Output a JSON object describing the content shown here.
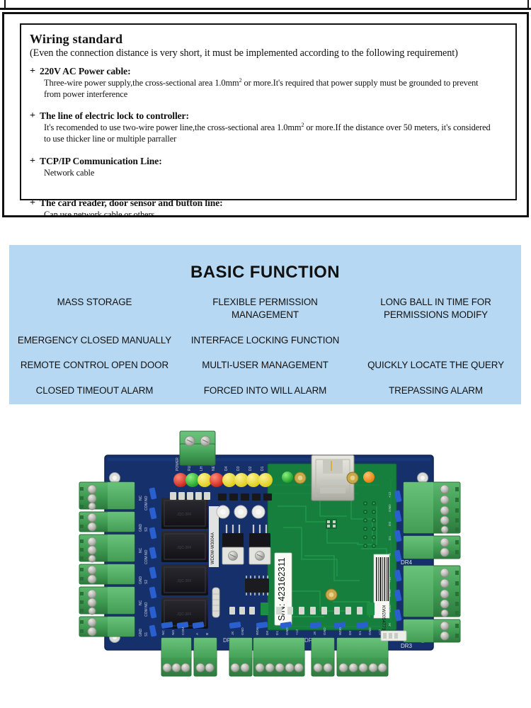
{
  "wiring": {
    "title": "Wiring standard",
    "subtitle": "(Even the connection distance  is very short, it must be implemented  according to the following requirement)",
    "bullet_glyph": "+",
    "sections": [
      {
        "heading": "220V AC Power cable:",
        "body_line1": "Three-wire power supply,the cross-sectional area 1.0mm",
        "body_sup1": "2",
        "body_line1b": " or more.It's required that power supply must be grounded to prevent",
        "body_line2": "from power interference",
        "body_line3": ""
      },
      {
        "heading": "The line of electric lock to controller:",
        "body_line1": "It's recomended to use two-wire power line,the cross-sectional area 1.0mm",
        "body_sup1": "2",
        "body_line1b": "  or more.If the distance over 50 meters, it's considered",
        "body_line2": "to use  thicker line or multiple parraller",
        "body_line3": ""
      },
      {
        "heading": "TCP/IP  Communication Line:",
        "body_line1": "Network cable",
        "body_sup1": "",
        "body_line1b": "",
        "body_line2": "",
        "body_line3": ""
      },
      {
        "heading": "The card reader, door sensor and button line:",
        "body_line1": "Can use network cable or others",
        "body_sup1": "",
        "body_line1b": "",
        "body_line2": "",
        "body_line3": ""
      }
    ]
  },
  "basic_function": {
    "title": "BASIC FUNCTION",
    "panel_color": "#b7d8f2",
    "items": [
      "MASS STORAGE",
      "FLEXIBLE  PERMISSION MANAGEMENT",
      "LONG BALL IN TIME FOR PERMISSIONS MODIFY",
      "EMERGENCY CLOSED MANUALLY",
      "INTERFACE LOCKING FUNCTION",
      "",
      "REMOTE CONTROL OPEN DOOR",
      "MULTI-USER MANAGEMENT",
      "QUICKLY LOCATE THE QUERY",
      "CLOSED TIMEOUT ALARM",
      "FORCED INTO WILL ALARM",
      "TREPASSING ALARM"
    ]
  },
  "pcb": {
    "serial_label": "S/N: 423162311",
    "barcode_label": "KW20547730668",
    "silk_labels": {
      "dr4": "DR4",
      "dr3": "DR3",
      "dr1": "DR1",
      "dr2": "DR2"
    },
    "leds": [
      {
        "name": "POWER",
        "color": "#e03020"
      },
      {
        "name": "RUN",
        "color": "#2fbb30"
      },
      {
        "name": "LH",
        "color": "#e8d81c"
      },
      {
        "name": "NET",
        "color": "#e03020"
      },
      {
        "name": "D4",
        "color": "#e8d81c"
      },
      {
        "name": "D3",
        "color": "#e8d81c"
      },
      {
        "name": "D2",
        "color": "#e8d81c"
      },
      {
        "name": "D1",
        "color": "#e8d81c"
      }
    ],
    "module_leds": [
      {
        "name": "link-led",
        "color": "#34c442"
      },
      {
        "name": "act-led",
        "color": "#f08a16"
      }
    ],
    "colors": {
      "board_blue": "#16306b",
      "module_green": "#16803c",
      "terminal_green": "#3f9d52",
      "relay_black": "#15151a",
      "pad_gold": "#c8a448",
      "metal_silver": "#cfd0cb"
    }
  }
}
